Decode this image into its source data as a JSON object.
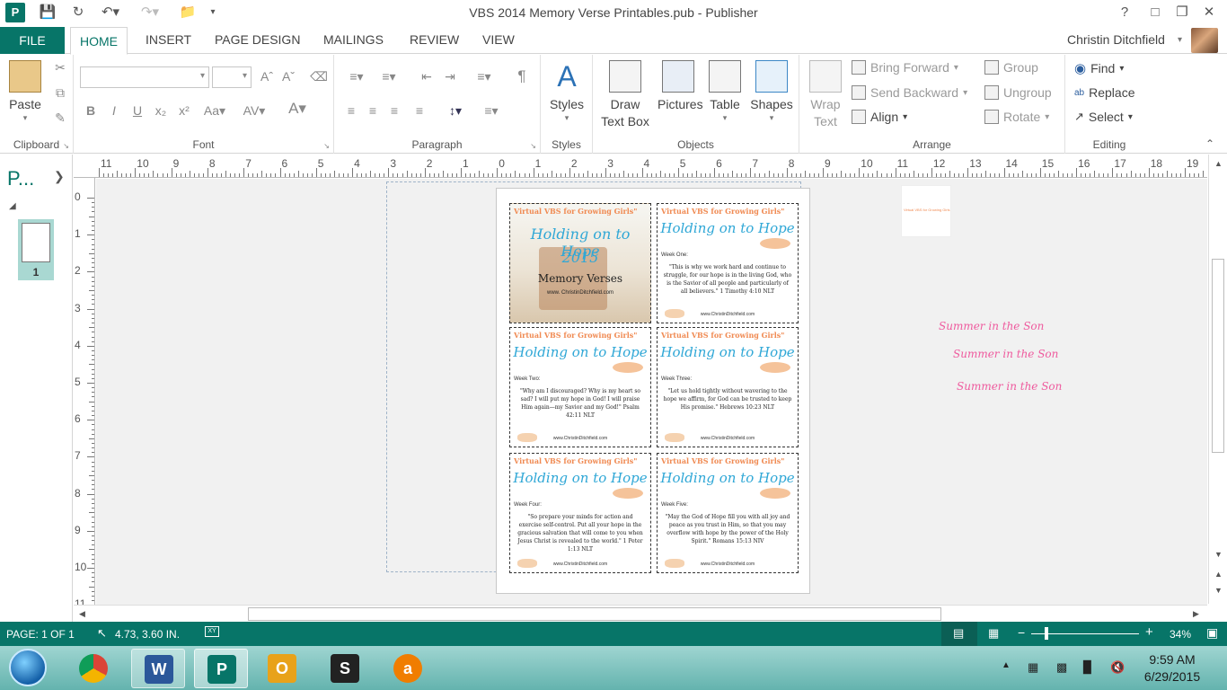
{
  "window": {
    "title": "VBS 2014 Memory Verse Printables.pub - Publisher",
    "help": "?",
    "app_letter": "P"
  },
  "tabs": [
    "FILE",
    "HOME",
    "INSERT",
    "PAGE DESIGN",
    "MAILINGS",
    "REVIEW",
    "VIEW"
  ],
  "user": {
    "name": "Christin Ditchfield"
  },
  "ribbon": {
    "clipboard": {
      "label": "Clipboard",
      "paste": "Paste"
    },
    "font": {
      "label": "Font"
    },
    "paragraph": {
      "label": "Paragraph"
    },
    "styles": {
      "label": "Styles",
      "button": "Styles"
    },
    "objects": {
      "label": "Objects",
      "draw_text_box_1": "Draw",
      "draw_text_box_2": "Text Box",
      "pictures": "Pictures",
      "table": "Table",
      "shapes": "Shapes"
    },
    "arrange": {
      "label": "Arrange",
      "wrap_text_1": "Wrap",
      "wrap_text_2": "Text",
      "bring_forward": "Bring Forward",
      "send_backward": "Send Backward",
      "align": "Align",
      "group": "Group",
      "ungroup": "Ungroup",
      "rotate": "Rotate"
    },
    "editing": {
      "label": "Editing",
      "find": "Find",
      "replace": "Replace",
      "select": "Select"
    }
  },
  "pages_panel": {
    "title": "P...",
    "page_number": "1"
  },
  "ruler": {
    "horizontal": [
      "11",
      "10",
      "9",
      "8",
      "7",
      "6",
      "5",
      "4",
      "3",
      "2",
      "1",
      "0",
      "1",
      "2",
      "3",
      "4",
      "5",
      "6",
      "7",
      "8",
      "9",
      "10",
      "11",
      "12",
      "13",
      "14",
      "15",
      "16",
      "17",
      "18",
      "19"
    ],
    "vertical": [
      "0",
      "1",
      "2",
      "3",
      "4",
      "5",
      "6",
      "7",
      "8",
      "9",
      "10",
      "11"
    ]
  },
  "document": {
    "brand": "Virtual VBS for Growing Girls\"",
    "site": "www.ChristinDitchfield.com",
    "cover": {
      "heading": "Holding on to Hope",
      "year": "2015",
      "subtitle": "Memory Verses",
      "site": "www. ChristinDitchfield.com"
    },
    "cards": [
      {
        "heading": "Holding on to Hope",
        "week": "Week One:",
        "verse": "\"This is why we work hard and continue to struggle, for our hope is in the living God, who is the Savior of all people and particularly of all believers.\" 1 Timothy 4:10 NLT"
      },
      {
        "heading": "Holding on to Hope",
        "week": "Week Two:",
        "verse": "\"Why am I discouraged? Why is my heart so sad? I will put my hope in God! I will praise Him again—my Savior and my God!\" Psalm 42:11 NLT"
      },
      {
        "heading": "Holding on to Hope",
        "week": "Week Three:",
        "verse": "\"Let us hold tightly without wavering to the hope we affirm, for God can be trusted to keep His promise.\" Hebrews 10:23 NLT"
      },
      {
        "heading": "Holding on to Hope",
        "week": "Week Four:",
        "verse": "\"So prepare your minds for action and exercise self-control. Put all your hope in the gracious salvation that will come to you when Jesus Christ is revealed to the world.\" 1 Peter 1:13 NLT"
      },
      {
        "heading": "Holding on to Hope",
        "week": "Week Five:",
        "verse": "\"May the God of Hope fill you with all joy and peace as you trust in Him, so that you may overflow with hope by the power of the Holy Spirit.\" Romans 15:13 NIV"
      }
    ],
    "scratch_text": "Virtual VBS for Growing Girls",
    "summer": [
      "Summer in the Son",
      "Summer in the Son",
      "Summer in the Son"
    ]
  },
  "status": {
    "page": "PAGE: 1 OF 1",
    "position": "4.73, 3.60 IN.",
    "zoom": "34%",
    "zoom_level": 0.34
  },
  "taskbar": {
    "time": "9:59 AM",
    "date": "6/29/2015"
  },
  "colors": {
    "accent": "#077568",
    "heading_blue": "#2fa7d6",
    "brand_orange": "#f08a52",
    "summer_pink": "#ef5a9e"
  }
}
